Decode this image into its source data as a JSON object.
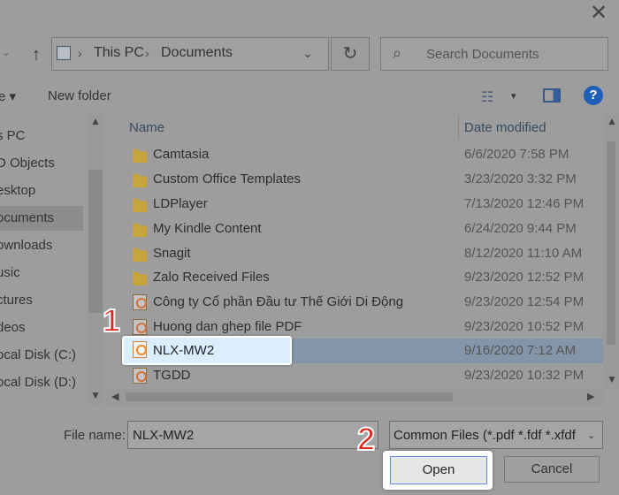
{
  "title_bar": {
    "close_glyph": "✕"
  },
  "address": {
    "up_glyph": "↑",
    "sep": "›",
    "crumbs": [
      "This PC",
      "Documents"
    ],
    "dropdown_glyph": "⌄",
    "refresh_glyph": "↻"
  },
  "search": {
    "placeholder": "Search Documents",
    "icon_glyph": "⌕"
  },
  "toolbar": {
    "organize_label": "e ▾",
    "new_folder_label": "New folder",
    "view_glyph": "☷",
    "view_drop": "▾",
    "help_glyph": "?"
  },
  "nav": {
    "items": [
      {
        "label": "s PC"
      },
      {
        "label": "D Objects"
      },
      {
        "label": "esktop"
      },
      {
        "label": "ocuments"
      },
      {
        "label": "ownloads"
      },
      {
        "label": "usic"
      },
      {
        "label": "ctures"
      },
      {
        "label": "deos"
      },
      {
        "label": "ocal Disk (C:)"
      },
      {
        "label": "ocal Disk (D:)"
      }
    ],
    "selected_index": 3,
    "up_glyph": "▲",
    "down_glyph": "▼"
  },
  "list": {
    "col_name": "Name",
    "col_date": "Date modified",
    "rows": [
      {
        "name": "Camtasia",
        "date": "6/6/2020 7:58 PM",
        "type": "folder"
      },
      {
        "name": "Custom Office Templates",
        "date": "3/23/2020 3:32 PM",
        "type": "folder"
      },
      {
        "name": "LDPlayer",
        "date": "7/13/2020 12:46 PM",
        "type": "folder"
      },
      {
        "name": "My Kindle Content",
        "date": "6/24/2020 9:44 PM",
        "type": "folder"
      },
      {
        "name": "Snagit",
        "date": "8/12/2020 11:10 AM",
        "type": "folder"
      },
      {
        "name": "Zalo Received Files",
        "date": "9/23/2020 12:52 PM",
        "type": "folder"
      },
      {
        "name": "Công ty Cổ phần Đầu tư Thế Giới Di Động",
        "date": "9/23/2020 12:54 PM",
        "type": "pdf"
      },
      {
        "name": "Huong dan ghep file PDF",
        "date": "9/23/2020 10:52 PM",
        "type": "pdf"
      },
      {
        "name": "NLX-MW2",
        "date": "9/16/2020 7:12 AM",
        "type": "pdf",
        "selected": true
      },
      {
        "name": "TGDD",
        "date": "9/23/2020 10:32 PM",
        "type": "pdf"
      }
    ],
    "scroll_up": "▲",
    "scroll_down": "▼",
    "scroll_left": "◀",
    "scroll_right": "▶"
  },
  "bottom": {
    "file_name_label": "File name:",
    "file_name_value": "NLX-MW2",
    "file_type_value": "Common Files (*.pdf *.fdf *.xfdf",
    "file_type_drop": "⌄",
    "open_label": "Open",
    "cancel_label": "Cancel"
  },
  "annotations": {
    "step1": "1",
    "step2": "2"
  },
  "colors": {
    "accent": "#1f5fb8",
    "badge_red": "#e1251b",
    "selection": "#dbeeff"
  }
}
